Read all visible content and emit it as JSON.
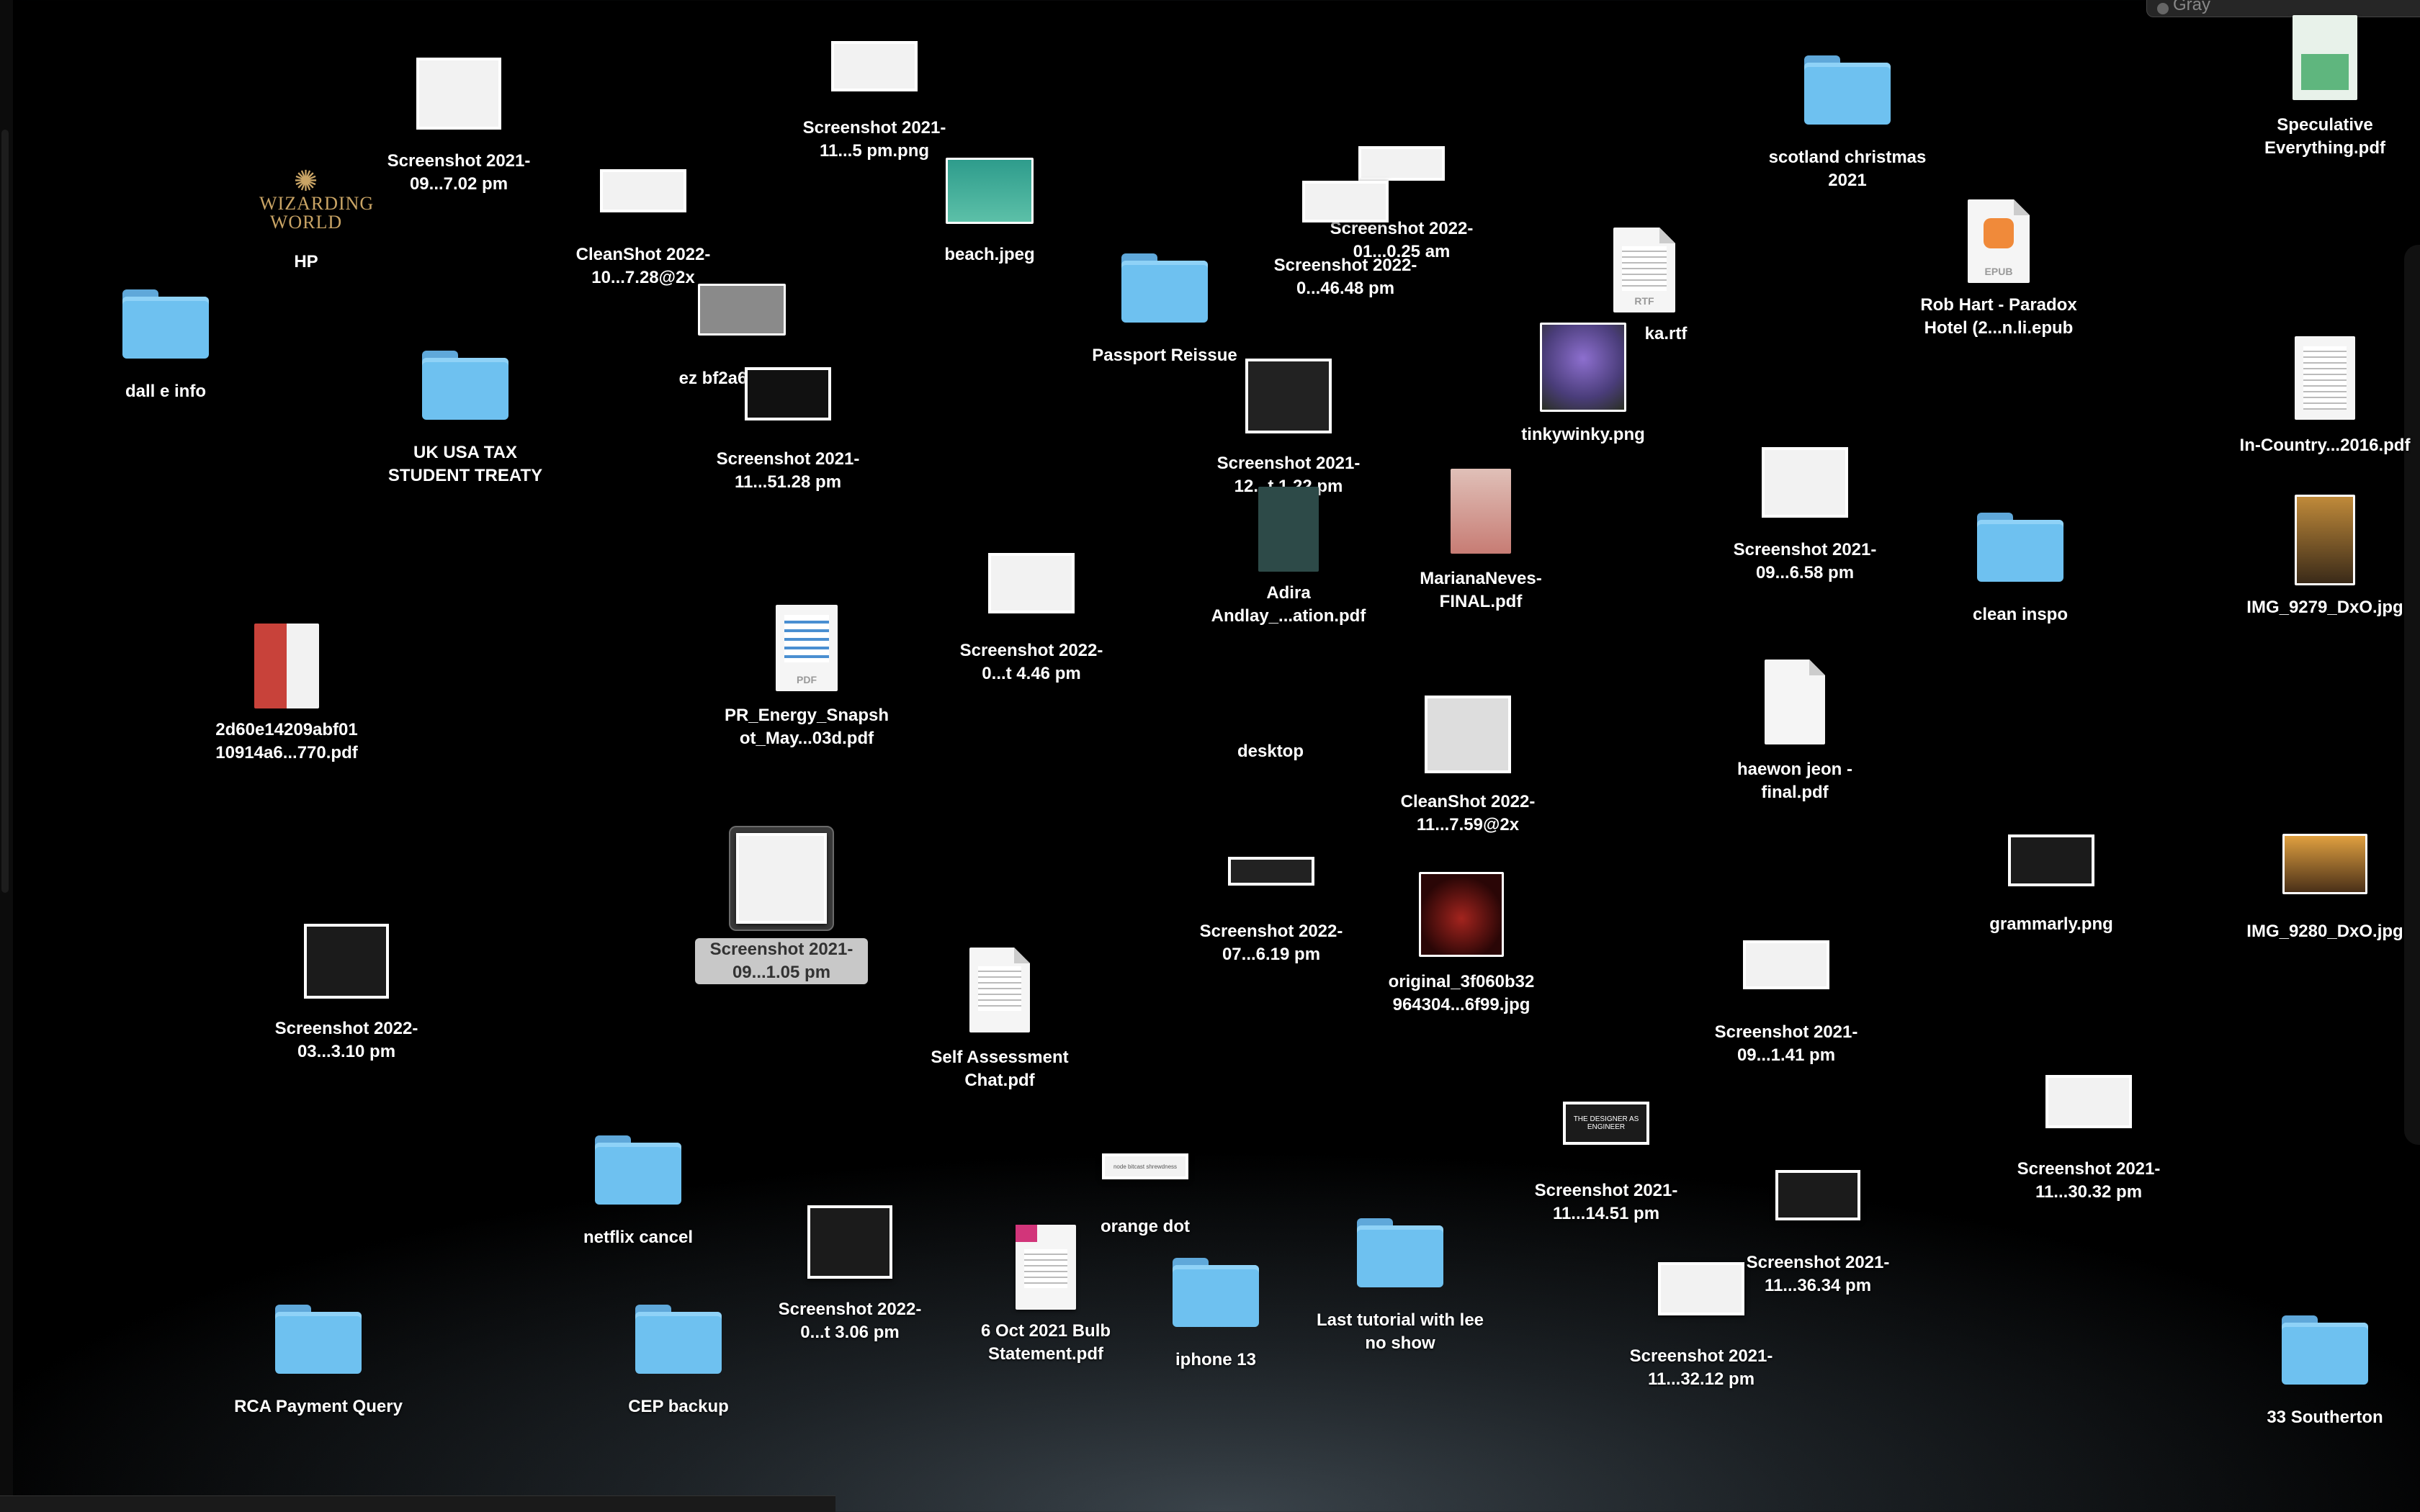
{
  "top_pill": {
    "label": "Gray"
  },
  "desktop": {
    "items": [
      {
        "label": "Screenshot 2021-09...7.02 pm"
      },
      {
        "label": "Screenshot 2021-11...5 pm.png"
      },
      {
        "label": "HP"
      },
      {
        "label": "CleanShot 2022-10...7.28@2x"
      },
      {
        "label": "beach.jpeg"
      },
      {
        "label": "dall e info"
      },
      {
        "label": "ez bf2a6"
      },
      {
        "label": "UK USA TAX STUDENT TREATY"
      },
      {
        "label": "Screenshot 2021-11...51.28 pm"
      },
      {
        "label": "Passport Reissue"
      },
      {
        "label": "Screenshot 2022-01...0.25 am"
      },
      {
        "label": "Screenshot 2022-0...46.48 pm"
      },
      {
        "label": "ka.rtf"
      },
      {
        "label": "scotland christmas 2021"
      },
      {
        "label": "Speculative Everything.pdf"
      },
      {
        "label": "Rob Hart - Paradox Hotel (2...n.li.epub"
      },
      {
        "label": "tinkywinky.png"
      },
      {
        "label": "Screenshot 2021-12...t 1.22 pm"
      },
      {
        "label": "In-Country...2016.pdf"
      },
      {
        "label": "Adira Andlay_...ation.pdf"
      },
      {
        "label": "MarianaNeves-FINAL.pdf"
      },
      {
        "label": "Screenshot 2021-09...6.58 pm"
      },
      {
        "label": "clean inspo"
      },
      {
        "label": "IMG_9279_DxO.jpg"
      },
      {
        "label": "2d60e14209abf01 10914a6...770.pdf"
      },
      {
        "label": "PR_Energy_Snapshot_May...03d.pdf"
      },
      {
        "label": "Screenshot 2022-0...t 4.46 pm"
      },
      {
        "label": "desktop"
      },
      {
        "label": "CleanShot 2022-11...7.59@2x"
      },
      {
        "label": "haewon jeon - final.pdf"
      },
      {
        "label": "Screenshot 2021-09...1.05 pm"
      },
      {
        "label": "Screenshot 2022-07...6.19 pm"
      },
      {
        "label": "original_3f060b32 964304...6f99.jpg"
      },
      {
        "label": "grammarly.png"
      },
      {
        "label": "IMG_9280_DxO.jpg"
      },
      {
        "label": "Screenshot 2022-03...3.10 pm"
      },
      {
        "label": "Self Assessment Chat.pdf"
      },
      {
        "label": "Screenshot 2021-09...1.41 pm"
      },
      {
        "label": "netflix cancel"
      },
      {
        "label": "orange dot"
      },
      {
        "label": "Screenshot 2021-11...14.51 pm"
      },
      {
        "label": "Screenshot 2021-11...30.32 pm"
      },
      {
        "label": "Screenshot 2022-0...t 3.06 pm"
      },
      {
        "label": "6 Oct 2021 Bulb Statement.pdf"
      },
      {
        "label": "iphone 13"
      },
      {
        "label": "Last tutorial with lee no show"
      },
      {
        "label": "Screenshot 2021-11...36.34 pm"
      },
      {
        "label": "Screenshot 2021-11...32.12 pm"
      },
      {
        "label": "RCA Payment Query"
      },
      {
        "label": "CEP backup"
      },
      {
        "label": "33 Southerton"
      }
    ],
    "selected_index": 30
  },
  "thumb_text": {
    "hp_logo": "WIZARDING WORLD",
    "epub_tag": "EPUB",
    "rtf_tag": "RTF",
    "pdf_tag": "PDF",
    "designer_thumb": "THE DESIGNER AS ENGINEER",
    "orange_dot_thumb": "node bitcast shrewdness"
  },
  "colors": {
    "folder": "#6ec1f0",
    "selection": "#c8c8c8",
    "background": "#000000"
  }
}
